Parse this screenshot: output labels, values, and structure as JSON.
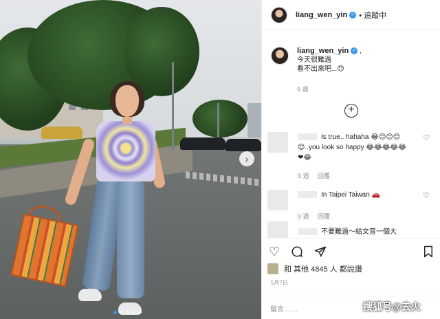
{
  "post": {
    "username": "liang_wen_yin",
    "follow_status": "追蹤中",
    "caption_line1": "今天很難過",
    "caption_line2": "看不出來吧...😞",
    "caption_time": "9 週",
    "load_more_icon": "plus-circle-icon"
  },
  "comments": [
    {
      "line1": "Is true.. hahaha 😂😊😊😊",
      "line2": "😊..you look so happy 😂😂😂😂😂",
      "line3": "❤😂",
      "time": "9 週",
      "reply": "回覆"
    },
    {
      "line1": "In Taipei Taiwan 🚗",
      "time": "9 週",
      "reply": "回覆"
    },
    {
      "line1": "不要難過～給文音一個大"
    }
  ],
  "actions": {
    "like_icon": "heart-icon",
    "comment_icon": "comment-icon",
    "share_icon": "paper-plane-icon",
    "save_icon": "bookmark-icon"
  },
  "likes_text": "和 其他 4845 人 都說讚",
  "date": "5月7日",
  "comment_placeholder": "留言……",
  "watermark": "搜狐号@去火"
}
